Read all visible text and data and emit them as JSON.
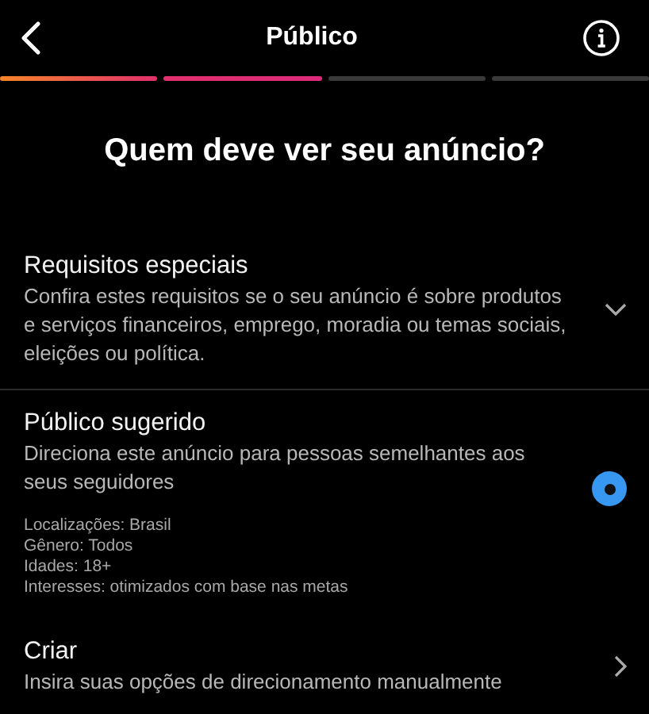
{
  "header": {
    "title": "Público"
  },
  "steps": [
    {
      "done": true
    },
    {
      "done": true
    },
    {
      "done": false
    },
    {
      "done": false
    }
  ],
  "question": "Quem deve ver seu anúncio?",
  "options": [
    {
      "kind": "expand",
      "title": "Requisitos especiais",
      "description": "Confira estes requisitos se o seu anúncio é sobre produtos e serviços financeiros, emprego, moradia ou temas sociais, eleições ou política."
    },
    {
      "kind": "radio",
      "title": "Público sugerido",
      "description": "Direciona este anúncio para pessoas semelhantes aos seus seguidores",
      "selected": true,
      "details": [
        "Localizações: Brasil",
        "Gênero: Todos",
        "Idades: 18+",
        "Interesses: otimizados com base nas metas"
      ]
    },
    {
      "kind": "link",
      "title": "Criar",
      "description": "Insira suas opções de direcionamento manualmente"
    }
  ]
}
